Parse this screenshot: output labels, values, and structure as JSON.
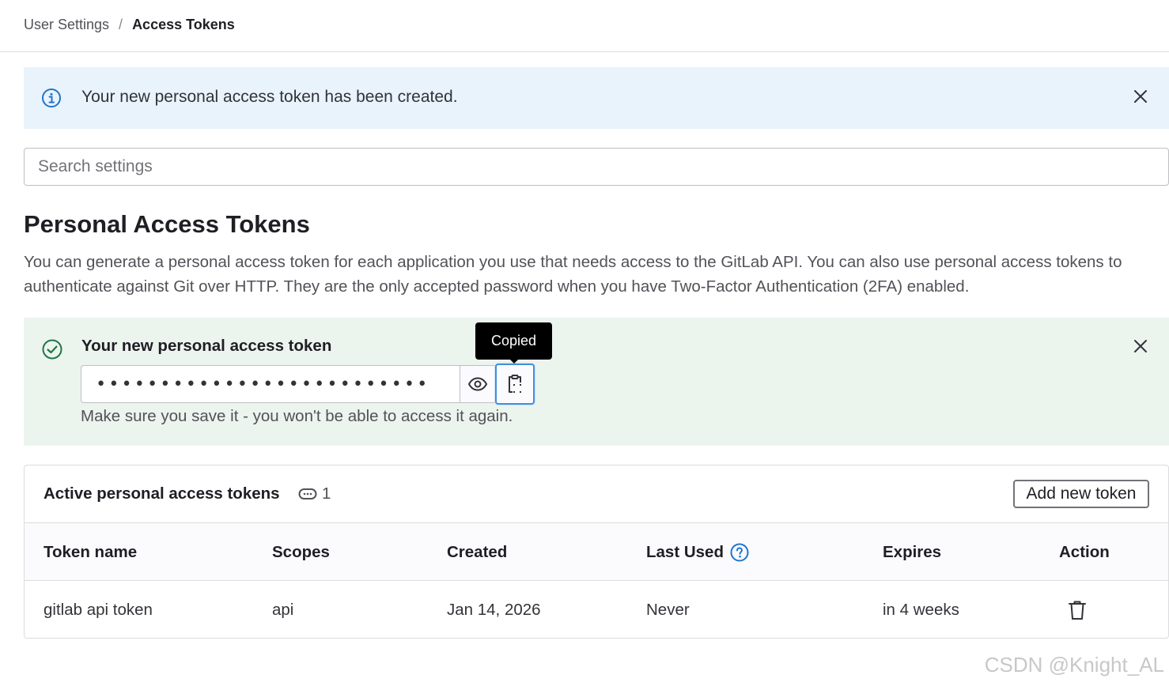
{
  "breadcrumb": {
    "parent": "User Settings",
    "separator": "/",
    "current": "Access Tokens"
  },
  "info_alert": {
    "message": "Your new personal access token has been created."
  },
  "search": {
    "placeholder": "Search settings"
  },
  "page": {
    "title": "Personal Access Tokens",
    "description": "You can generate a personal access token for each application you use that needs access to the GitLab API. You can also use personal access tokens to authenticate against Git over HTTP. They are the only accepted password when you have Two-Factor Authentication (2FA) enabled."
  },
  "success_alert": {
    "title": "Your new personal access token",
    "masked_token": "••••••••••••••••••••••••••",
    "tooltip": "Copied",
    "hint": "Make sure you save it - you won't be able to access it again."
  },
  "tokens_card": {
    "title": "Active personal access tokens",
    "count": "1",
    "add_button": "Add new token",
    "columns": {
      "name": "Token name",
      "scopes": "Scopes",
      "created": "Created",
      "last_used": "Last Used",
      "expires": "Expires",
      "action": "Action"
    },
    "rows": [
      {
        "name": "gitlab api token",
        "scopes": "api",
        "created": "Jan 14, 2026",
        "last_used": "Never",
        "expires": "in 4 weeks"
      }
    ]
  },
  "watermark": "CSDN @Knight_AL",
  "colors": {
    "info_bg": "#e9f3fc",
    "info_icon": "#1f75cb",
    "success_bg": "#ecf4ee",
    "success_icon": "#217645",
    "focus_ring": "#428fdc"
  }
}
